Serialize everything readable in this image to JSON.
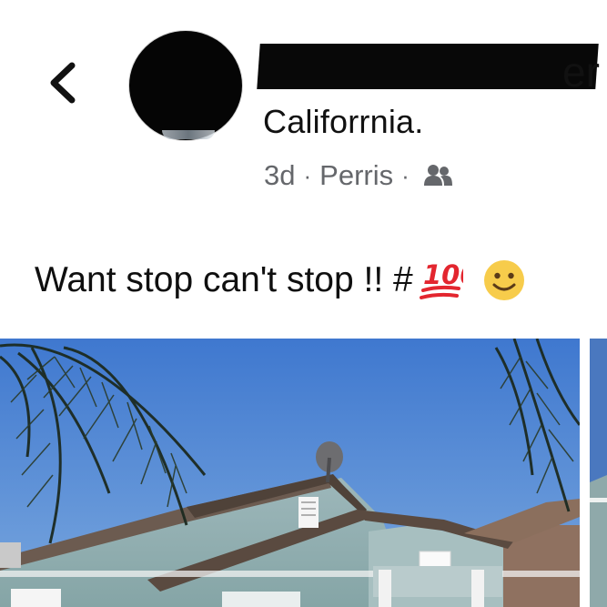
{
  "header": {
    "back_icon": "chevron-left-icon",
    "name_visible_fragment": "er",
    "location_title": "Califorrnia.",
    "meta": {
      "time": "3d",
      "place": "Perris",
      "separator": "·",
      "audience_icon": "friends-icon"
    }
  },
  "post": {
    "text": "Want stop can't stop !! #",
    "emojis": [
      "hundred-points-emoji",
      "slightly-smiling-face-emoji"
    ]
  },
  "media": {
    "photo_description": "house"
  },
  "colors": {
    "meta_gray": "#65676b",
    "sky": "#4f83d0",
    "siding": "#8eb2b4"
  }
}
